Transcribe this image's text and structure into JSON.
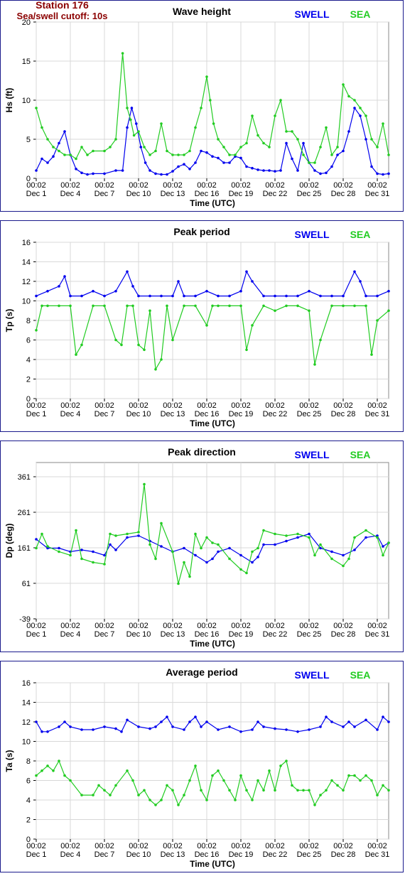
{
  "station": {
    "name": "Station 176",
    "cutoff": "Sea/swell cutoff: 10s"
  },
  "colors": {
    "swell": "#0000ee",
    "sea": "#22cc22",
    "frame": "#1a1a8c",
    "grid": "#d8d8d8",
    "station": "#8b0000"
  },
  "legend": {
    "swell": "SWELL",
    "sea": "SEA"
  },
  "x_axis": {
    "label": "Time (UTC)",
    "time_labels": [
      "00:02",
      "00:02",
      "00:02",
      "00:02",
      "00:02",
      "00:02",
      "00:02",
      "00:02",
      "00:02",
      "00:02",
      "00:02"
    ],
    "date_labels": [
      "Dec 1",
      "Dec 4",
      "Dec 7",
      "Dec 10",
      "Dec 13",
      "Dec 16",
      "Dec 19",
      "Dec 22",
      "Dec 25",
      "Dec 28",
      "Dec 31"
    ]
  },
  "chart_data": [
    {
      "type": "line",
      "title": "Wave height",
      "ylabel": "Hs (ft)",
      "ylim": [
        0,
        20
      ],
      "yticks": [
        "0",
        "5",
        "10",
        "15",
        "20"
      ],
      "x_unit": "day of December",
      "xlim": [
        1,
        32
      ],
      "series": [
        {
          "name": "SWELL",
          "x": [
            1,
            1.5,
            2,
            2.5,
            3,
            3.5,
            4,
            4.5,
            5,
            5.5,
            6,
            7,
            8,
            8.6,
            9,
            9.4,
            9.8,
            10.2,
            10.6,
            11,
            11.5,
            12,
            12.5,
            13,
            13.5,
            14,
            14.5,
            15,
            15.5,
            16,
            16.5,
            17,
            17.5,
            18,
            18.5,
            19,
            19.5,
            20,
            20.5,
            21,
            21.5,
            22,
            22.5,
            23,
            23.5,
            24,
            24.5,
            25,
            25.5,
            26,
            26.5,
            27,
            27.5,
            28,
            28.5,
            29,
            29.5,
            30,
            30.5,
            31,
            31.5,
            32
          ],
          "y": [
            1,
            2.5,
            2,
            2.8,
            4.5,
            6,
            3,
            1.2,
            0.7,
            0.5,
            0.6,
            0.6,
            1,
            1,
            6.5,
            9,
            7,
            4,
            2,
            1,
            0.6,
            0.5,
            0.5,
            0.9,
            1.5,
            1.8,
            1.2,
            2,
            3.5,
            3.3,
            2.8,
            2.6,
            2,
            2,
            2.8,
            2.6,
            1.5,
            1.3,
            1.1,
            1,
            1,
            0.9,
            1,
            4.5,
            2.5,
            1,
            4.5,
            2,
            1,
            0.6,
            0.7,
            1.5,
            3,
            3.5,
            6,
            9,
            8,
            5,
            1.5,
            0.6,
            0.5,
            0.6
          ]
        },
        {
          "name": "SEA",
          "x": [
            1,
            1.5,
            2,
            2.5,
            3,
            3.5,
            4,
            4.5,
            5,
            5.5,
            6,
            7,
            7.5,
            8,
            8.6,
            9,
            9.3,
            9.6,
            10,
            10.5,
            11,
            11.5,
            12,
            12.5,
            13,
            13.5,
            14,
            14.5,
            15,
            15.5,
            16,
            16.3,
            16.6,
            17,
            17.5,
            18,
            18.5,
            19,
            19.5,
            20,
            20.5,
            21,
            21.5,
            22,
            22.5,
            23,
            23.5,
            24,
            24.5,
            25,
            25.5,
            26,
            26.5,
            27,
            27.5,
            28,
            28.5,
            29,
            29.5,
            30,
            30.5,
            31,
            31.5,
            32
          ],
          "y": [
            9,
            6.5,
            5,
            4,
            3.5,
            3,
            3,
            2.5,
            4,
            3,
            3.5,
            3.5,
            4,
            5,
            16,
            9,
            7.5,
            5.5,
            6,
            4,
            3,
            3.5,
            7,
            3.5,
            3,
            3,
            3,
            3.5,
            6.5,
            9,
            13,
            10,
            7,
            5,
            4,
            3,
            3,
            4,
            4.5,
            8,
            5.5,
            4.5,
            4,
            8,
            10,
            6,
            6,
            5,
            3,
            2,
            2,
            4,
            6.5,
            3,
            4,
            12,
            10.5,
            10,
            9,
            8,
            5,
            4,
            7,
            3
          ]
        }
      ]
    },
    {
      "type": "line",
      "title": "Peak period",
      "ylabel": "Tp (s)",
      "ylim": [
        0,
        16
      ],
      "yticks": [
        "0",
        "2",
        "4",
        "6",
        "8",
        "10",
        "12",
        "14",
        "16"
      ],
      "x_unit": "day of December",
      "xlim": [
        1,
        32
      ],
      "series": [
        {
          "name": "SWELL",
          "x": [
            1,
            2,
            3,
            3.5,
            4,
            5,
            6,
            7,
            8,
            9,
            9.5,
            10,
            11,
            12,
            13,
            13.5,
            14,
            15,
            16,
            17,
            18,
            19,
            19.5,
            20,
            21,
            22,
            23,
            24,
            25,
            26,
            27,
            28,
            29,
            29.5,
            30,
            31,
            32
          ],
          "y": [
            10.5,
            11,
            11.5,
            12.5,
            10.5,
            10.5,
            11,
            10.5,
            11,
            13,
            11.5,
            10.5,
            10.5,
            10.5,
            10.5,
            12,
            10.5,
            10.5,
            11,
            10.5,
            10.5,
            11,
            13,
            12,
            10.5,
            10.5,
            10.5,
            10.5,
            11,
            10.5,
            10.5,
            10.5,
            13,
            12,
            10.5,
            10.5,
            11
          ]
        },
        {
          "name": "SEA",
          "x": [
            1,
            1.5,
            2,
            3,
            4,
            4.5,
            5,
            6,
            7,
            8,
            8.5,
            9,
            9.5,
            10,
            10.5,
            11,
            11.5,
            12,
            12.5,
            13,
            14,
            15,
            16,
            16.5,
            17,
            18,
            19,
            19.5,
            20,
            21,
            22,
            23,
            24,
            25,
            25.5,
            26,
            27,
            28,
            29,
            30,
            30.5,
            31,
            32
          ],
          "y": [
            7,
            9.5,
            9.5,
            9.5,
            9.5,
            4.5,
            5.5,
            9.5,
            9.5,
            6,
            5.5,
            9.5,
            9.5,
            5.5,
            5,
            9,
            3,
            4,
            9.5,
            6,
            9.5,
            9.5,
            7.5,
            9.5,
            9.5,
            9.5,
            9.5,
            5,
            7.5,
            9.5,
            9,
            9.5,
            9.5,
            9,
            3.5,
            6,
            9.5,
            9.5,
            9.5,
            9.5,
            4.5,
            8,
            9
          ]
        }
      ]
    },
    {
      "type": "line",
      "title": "Peak direction",
      "ylabel": "Dp (deg)",
      "ylim": [
        -39,
        401
      ],
      "yticks": [
        "-39",
        "61",
        "161",
        "261",
        "361"
      ],
      "x_unit": "day of December",
      "xlim": [
        1,
        32
      ],
      "series": [
        {
          "name": "SWELL",
          "x": [
            1,
            2,
            3,
            4,
            5,
            6,
            7,
            7.5,
            8,
            9,
            10,
            11,
            12,
            13,
            14,
            15,
            16,
            16.5,
            17,
            18,
            19,
            20,
            20.5,
            21,
            22,
            23,
            24,
            25,
            26,
            27,
            28,
            29,
            30,
            31,
            31.5,
            32
          ],
          "y": [
            185,
            160,
            160,
            150,
            155,
            150,
            140,
            170,
            155,
            190,
            195,
            180,
            165,
            150,
            160,
            140,
            120,
            130,
            150,
            160,
            140,
            120,
            135,
            170,
            170,
            180,
            190,
            200,
            160,
            150,
            140,
            155,
            190,
            195,
            165,
            175
          ]
        },
        {
          "name": "SEA",
          "x": [
            1,
            1.5,
            2,
            3,
            4,
            4.5,
            5,
            6,
            7,
            7.5,
            8,
            9,
            10,
            10.5,
            11,
            11.5,
            12,
            13,
            13.5,
            14,
            14.5,
            15,
            15.5,
            16,
            16.5,
            17,
            18,
            19,
            19.5,
            20,
            20.5,
            21,
            22,
            23,
            24,
            25,
            25.5,
            26,
            27,
            28,
            28.5,
            29,
            30,
            31,
            31.5,
            32
          ],
          "y": [
            160,
            200,
            165,
            150,
            140,
            210,
            130,
            120,
            115,
            200,
            195,
            200,
            205,
            340,
            170,
            130,
            230,
            150,
            60,
            120,
            80,
            200,
            160,
            190,
            175,
            170,
            130,
            100,
            90,
            150,
            160,
            210,
            200,
            195,
            200,
            190,
            140,
            170,
            130,
            110,
            130,
            190,
            210,
            190,
            140,
            175
          ]
        }
      ]
    },
    {
      "type": "line",
      "title": "Average period",
      "ylabel": "Ta (s)",
      "ylim": [
        0,
        16
      ],
      "yticks": [
        "0",
        "2",
        "4",
        "6",
        "8",
        "10",
        "12",
        "14",
        "16"
      ],
      "x_unit": "day of December",
      "xlim": [
        1,
        32
      ],
      "series": [
        {
          "name": "SWELL",
          "x": [
            1,
            1.5,
            2,
            3,
            3.5,
            4,
            5,
            6,
            7,
            8,
            8.5,
            9,
            10,
            11,
            11.5,
            12,
            12.5,
            13,
            14,
            14.5,
            15,
            15.5,
            16,
            17,
            18,
            19,
            20,
            20.5,
            21,
            22,
            23,
            24,
            25,
            26,
            26.5,
            27,
            28,
            28.5,
            29,
            30,
            31,
            31.5,
            32
          ],
          "y": [
            12,
            11,
            11,
            11.5,
            12,
            11.5,
            11.2,
            11.2,
            11.5,
            11.3,
            11,
            12.2,
            11.5,
            11.3,
            11.5,
            12,
            12.5,
            11.5,
            11.2,
            12,
            12.5,
            11.5,
            12,
            11.2,
            11.5,
            11,
            11.2,
            12,
            11.5,
            11.3,
            11.2,
            11,
            11.2,
            11.5,
            12.5,
            12,
            11.5,
            12,
            11.5,
            12.2,
            11.2,
            12.5,
            12
          ]
        },
        {
          "name": "SEA",
          "x": [
            1,
            1.5,
            2,
            2.5,
            3,
            3.5,
            4,
            5,
            6,
            6.5,
            7,
            7.5,
            8,
            9,
            9.5,
            10,
            10.5,
            11,
            11.5,
            12,
            12.5,
            13,
            13.5,
            14,
            14.5,
            15,
            15.5,
            16,
            16.5,
            17,
            17.5,
            18,
            18.5,
            19,
            19.5,
            20,
            20.5,
            21,
            21.5,
            22,
            22.5,
            23,
            23.5,
            24,
            24.5,
            25,
            25.5,
            26,
            26.5,
            27,
            27.5,
            28,
            28.5,
            29,
            29.5,
            30,
            30.5,
            31,
            31.5,
            32
          ],
          "y": [
            6.5,
            7,
            7.5,
            7,
            8,
            6.5,
            6,
            4.5,
            4.5,
            5.5,
            5,
            4.5,
            5.5,
            7,
            6,
            4.5,
            5,
            4,
            3.5,
            4,
            5.5,
            5,
            3.5,
            4.5,
            6,
            7.5,
            5,
            4,
            6.5,
            7,
            6,
            5,
            4,
            6.5,
            5,
            4,
            6,
            5,
            7,
            5,
            7.5,
            8,
            5.5,
            5,
            5,
            5,
            3.5,
            4.5,
            5,
            6,
            5.5,
            5,
            6.5,
            6.5,
            6,
            6.5,
            6,
            4.5,
            5.5,
            5
          ]
        }
      ]
    }
  ]
}
